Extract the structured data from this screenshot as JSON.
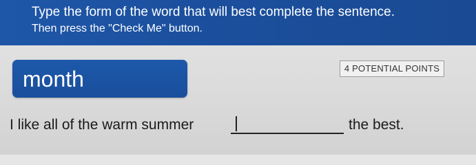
{
  "instructions": {
    "line1": "Type the form of the word that will best complete the sentence.",
    "line2": "Then press the \"Check Me\" button."
  },
  "question": {
    "word": "month",
    "points": "4 POTENTIAL POINTS",
    "sentence_before": "I like all of the warm summer",
    "answer_value": "",
    "sentence_after": "the best."
  },
  "colors": {
    "header_blue": "#1f57a8",
    "card_blue": "#1d58aa",
    "page_background": "#e0e0e0"
  }
}
